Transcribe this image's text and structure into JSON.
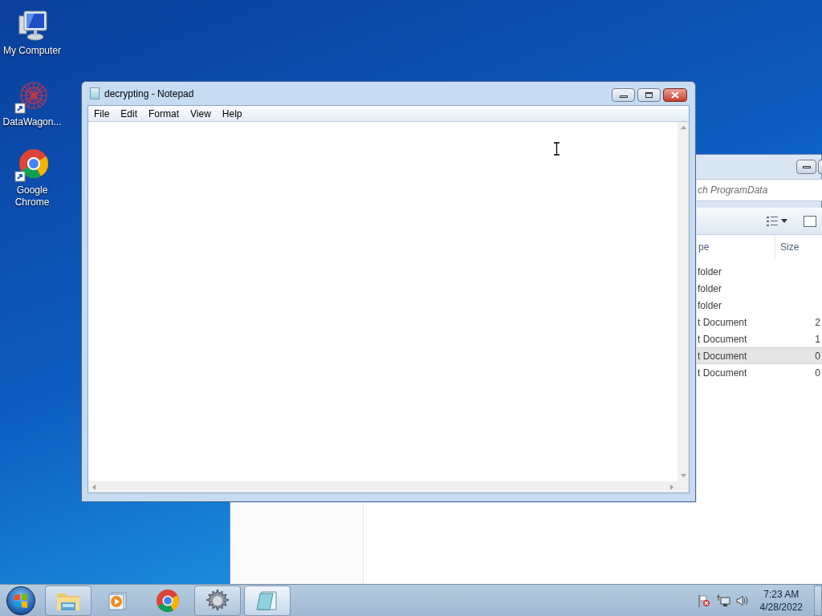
{
  "desktop_icons": [
    {
      "label": "My Computer",
      "kind": "computer"
    },
    {
      "label": "DataWagon...",
      "kind": "app"
    },
    {
      "label": "Google Chrome",
      "kind": "chrome"
    }
  ],
  "explorer_window": {
    "search_placeholder": "ch ProgramData",
    "columns": [
      "pe",
      "Size"
    ],
    "rows": [
      {
        "type": "folder",
        "selected": false
      },
      {
        "type": "folder",
        "selected": false
      },
      {
        "type": "folder",
        "selected": false
      },
      {
        "type": "t Document",
        "size": "2",
        "selected": false
      },
      {
        "type": "t Document",
        "size": "1",
        "selected": false
      },
      {
        "type": "t Document",
        "size": "0",
        "selected": true
      },
      {
        "type": "t Document",
        "size": "0",
        "selected": false
      }
    ]
  },
  "notepad": {
    "title": "decrypting - Notepad",
    "menu": [
      "File",
      "Edit",
      "Format",
      "View",
      "Help"
    ]
  },
  "taskbar": {
    "items": [
      {
        "kind": "explorer",
        "running": true,
        "selected": false
      },
      {
        "kind": "media",
        "running": false,
        "selected": false
      },
      {
        "kind": "chrome",
        "running": false,
        "selected": false
      },
      {
        "kind": "gear",
        "running": true,
        "selected": false
      },
      {
        "kind": "notepad",
        "running": true,
        "selected": true
      }
    ],
    "clock": {
      "time": "7:23 AM",
      "date": "4/28/2022"
    }
  }
}
